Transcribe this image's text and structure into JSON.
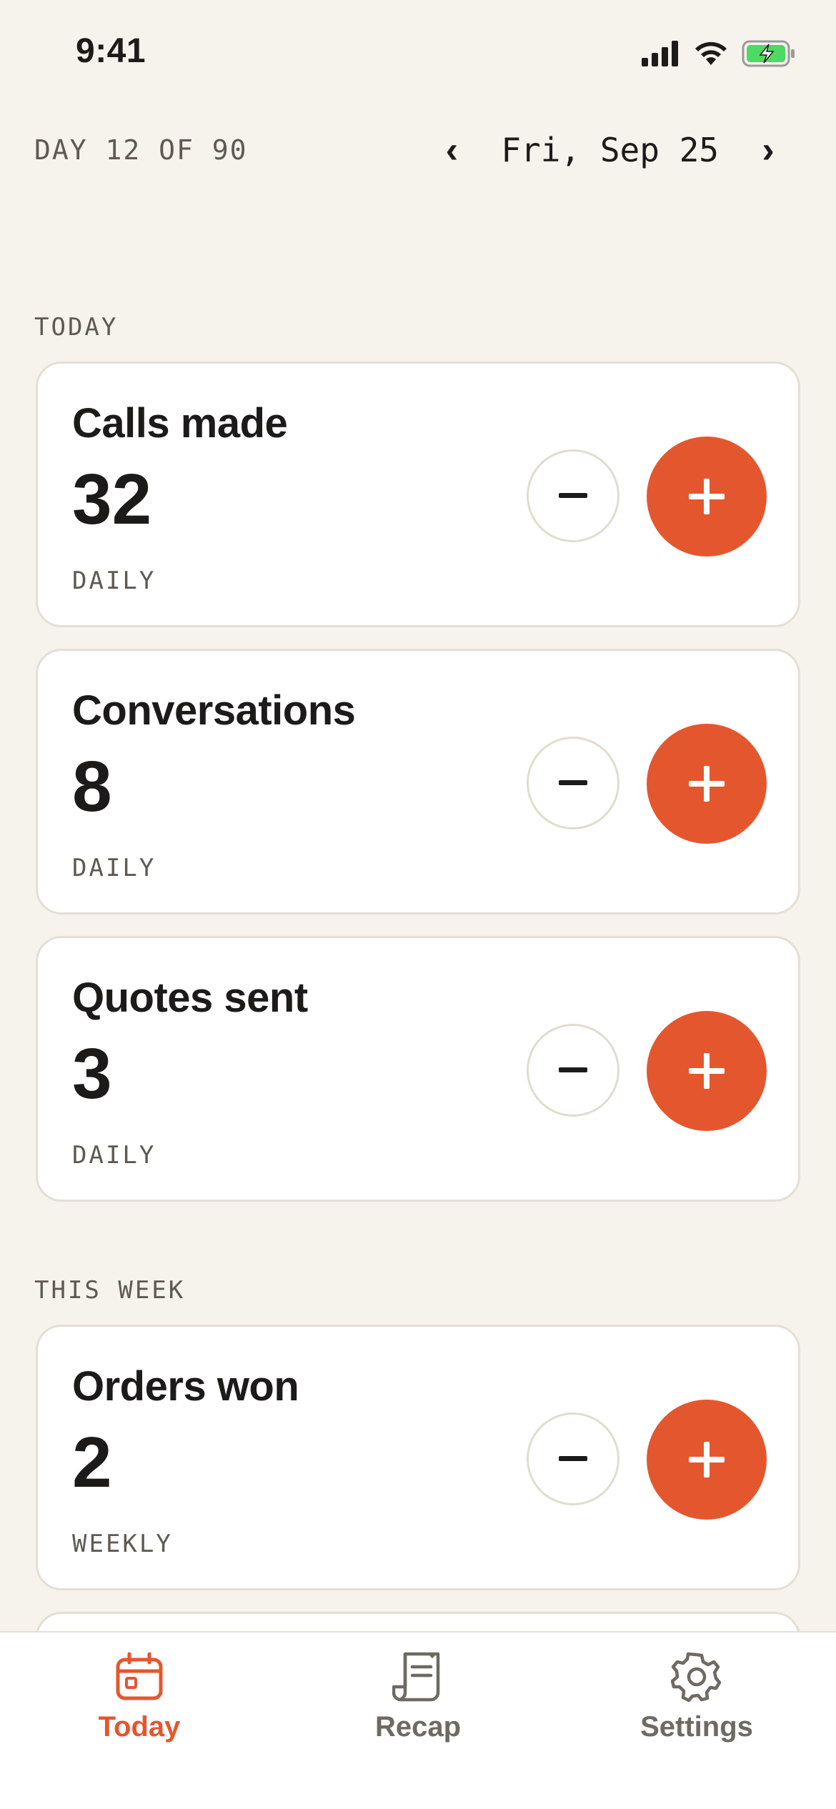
{
  "status": {
    "time": "9:41"
  },
  "header": {
    "day_counter": "DAY 12 OF 90",
    "date": "Fri, Sep 25",
    "prev_label": "‹",
    "next_label": "›"
  },
  "sections": [
    {
      "label": "TODAY",
      "cards": [
        {
          "title": "Calls made",
          "value": "32",
          "frequency": "DAILY"
        },
        {
          "title": "Conversations",
          "value": "8",
          "frequency": "DAILY"
        },
        {
          "title": "Quotes sent",
          "value": "3",
          "frequency": "DAILY"
        }
      ]
    },
    {
      "label": "THIS WEEK",
      "cards": [
        {
          "title": "Orders won",
          "value": "2",
          "frequency": "WEEKLY"
        }
      ]
    }
  ],
  "tabs": [
    {
      "label": "Today",
      "icon": "calendar-icon",
      "active": true
    },
    {
      "label": "Recap",
      "icon": "receipt-icon",
      "active": false
    },
    {
      "label": "Settings",
      "icon": "gear-icon",
      "active": false
    }
  ],
  "colors": {
    "accent": "#e4572e",
    "background": "#f6f3ec",
    "card": "#ffffff",
    "battery": "#4cd964"
  }
}
